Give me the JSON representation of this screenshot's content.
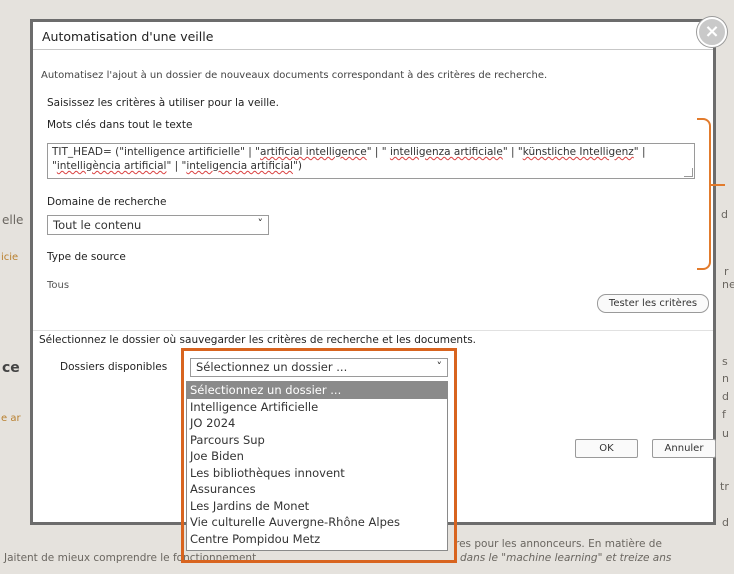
{
  "background": {
    "fragments": [
      "elle",
      "ce",
      "Jaitent de mieux comprendre le fonctionnement",
      "res pour les annonceurs. En matière de",
      "dans le \"machine learning\" et treize ans",
      "icie",
      "e ar",
      "d",
      "r",
      "ne",
      "s",
      "n",
      "d",
      "f",
      "u",
      "tr",
      "d"
    ]
  },
  "dialog": {
    "title": "Automatisation d'une veille",
    "close_symbol": "×",
    "intro": "Automatisez l'ajout à un dossier de nouveaux documents correspondant à des critères de recherche.",
    "criteria_label": "Saisissez les critères à utiliser pour la veille.",
    "keywords_label": "Mots clés dans tout le texte",
    "keywords_value_parts": [
      "TIT_HEAD= (\"intelligence artificielle\" | \"",
      "artificial intelligence",
      "\" | \" ",
      "intelligenza artificiale",
      "\" | \"",
      "künstliche Intelligenz",
      "\" | \"",
      "intelligència artificial",
      "\" | \"",
      "inteligencia artificial",
      "\")"
    ],
    "domain_label": "Domaine de recherche",
    "domain_value": "Tout le contenu",
    "source_label": "Type de source",
    "source_value": "Tous",
    "test_button": "Tester les critères",
    "folder_label": "Sélectionnez le dossier où sauvegarder les critères de recherche et les documents.",
    "folders_available_label": "Dossiers disponibles",
    "folder_select_value": "Sélectionnez un dossier ...",
    "folder_options": [
      "Sélectionnez un dossier ...",
      "Intelligence Artificielle",
      "JO 2024",
      "Parcours Sup",
      "Joe Biden",
      "Les bibliothèques innovent",
      "Assurances",
      "Les Jardins de Monet",
      "Vie culturelle Auvergne-Rhône Alpes",
      "Centre Pompidou Metz"
    ],
    "ok_button": "OK",
    "cancel_button": "Annuler"
  },
  "colors": {
    "annotation_orange": "#d8641f",
    "dialog_border": "#6c6c6c",
    "selected_option_bg": "#8a8a8a"
  }
}
